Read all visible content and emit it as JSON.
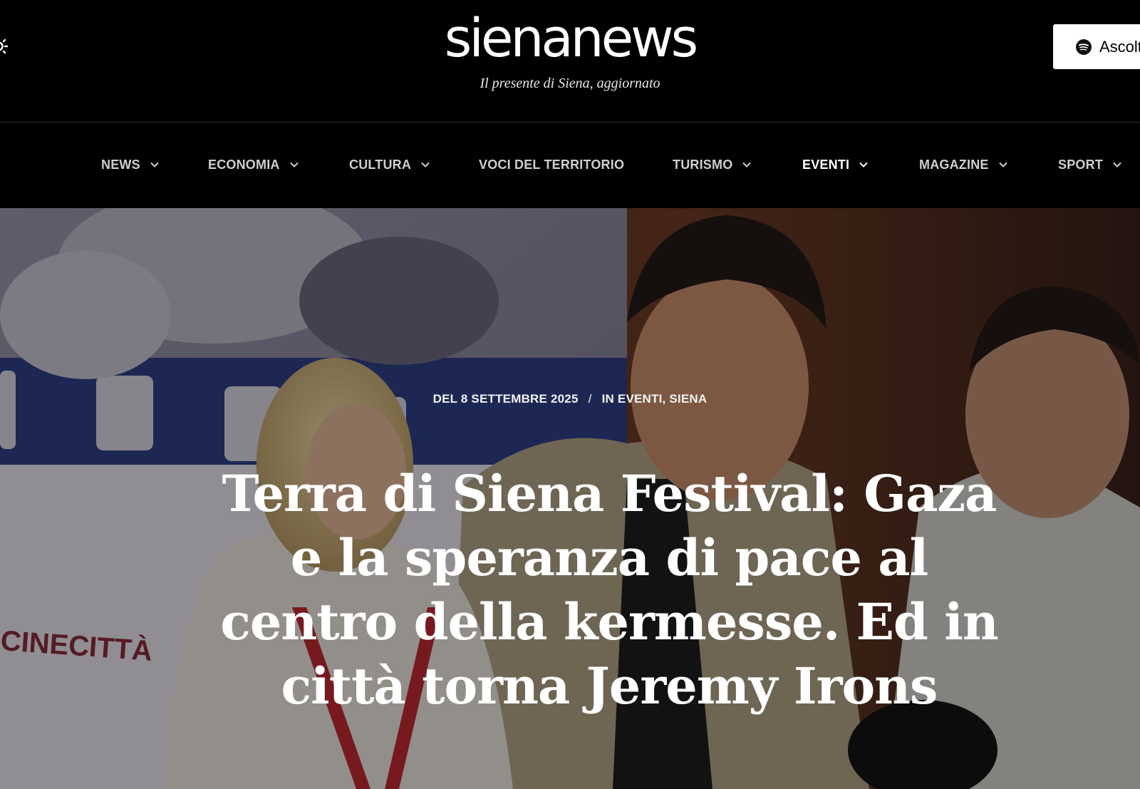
{
  "header": {
    "logo_text": "sienanews",
    "tagline": "Il presente di Siena, aggiornato",
    "listen_button_label": "Ascolta",
    "theme_toggle_icon": "sun-icon",
    "listen_icon": "spotify-icon"
  },
  "nav": {
    "items": [
      {
        "label": "NEWS",
        "has_dropdown": true
      },
      {
        "label": "ECONOMIA",
        "has_dropdown": true
      },
      {
        "label": "CULTURA",
        "has_dropdown": true
      },
      {
        "label": "VOCI DEL TERRITORIO",
        "has_dropdown": false
      },
      {
        "label": "TURISMO",
        "has_dropdown": true
      },
      {
        "label": "EVENTI",
        "has_dropdown": true,
        "active": true
      },
      {
        "label": "MAGAZINE",
        "has_dropdown": true
      },
      {
        "label": "SPORT",
        "has_dropdown": true
      }
    ]
  },
  "article": {
    "date": "DEL 8 SETTEMBRE 2025",
    "separator": "/",
    "in_prefix": "IN",
    "categories": [
      "EVENTI",
      "SIENA"
    ],
    "category_separator": ",",
    "title": "Terra di Siena Festival: Gaza e la speranza di pace al centro della kermesse. Ed in città torna Jeremy Irons"
  },
  "hero_image": {
    "banner_text": "CINECITTÀ"
  },
  "colors": {
    "background": "#000000",
    "text": "#ffffff",
    "nav_text": "#cfcfcf",
    "listen_button_bg": "#ffffff"
  }
}
